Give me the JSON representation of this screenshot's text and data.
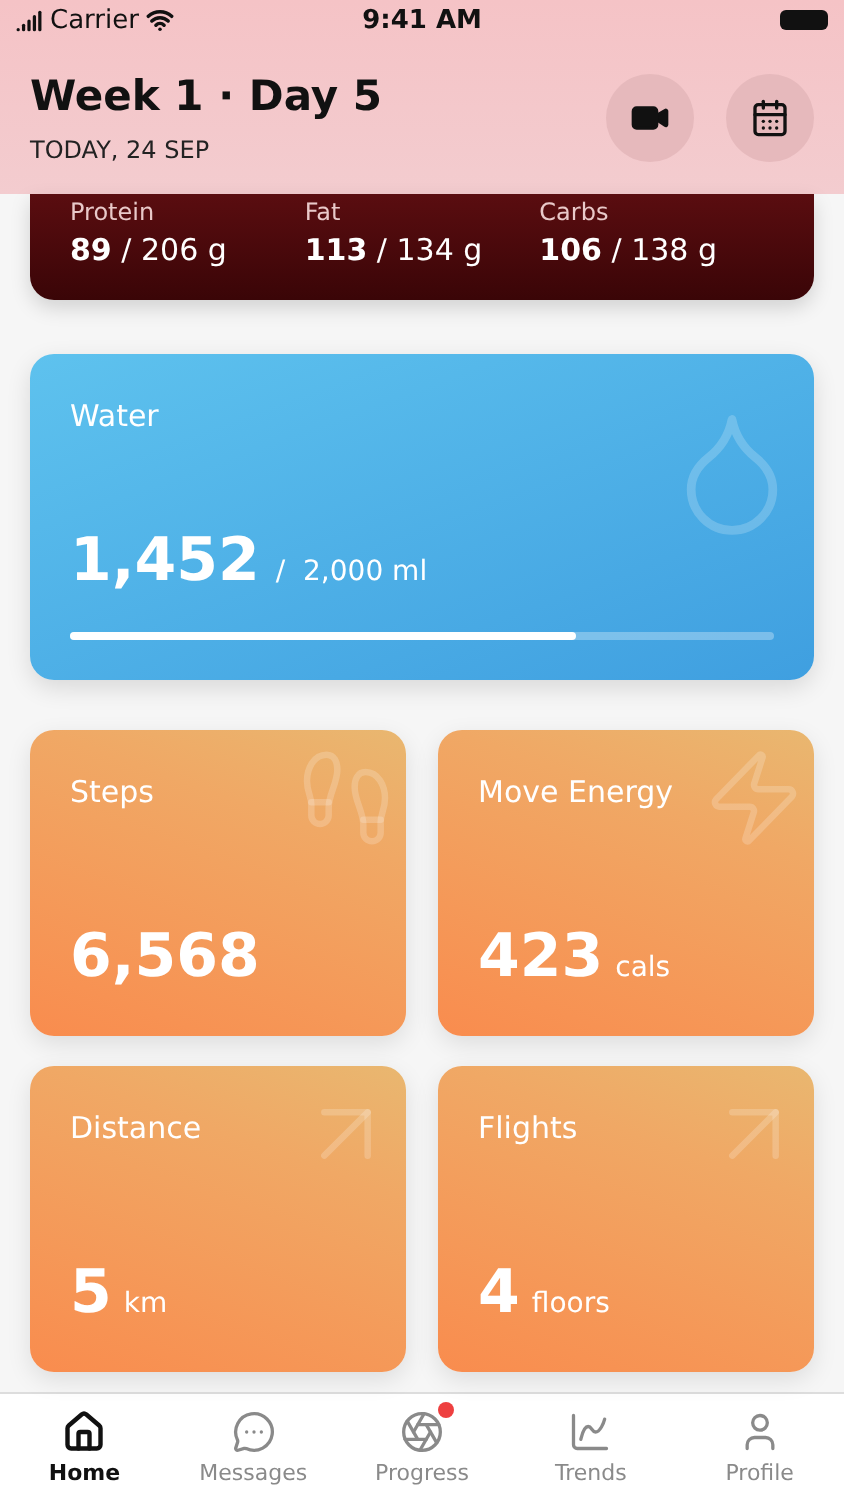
{
  "status_bar": {
    "carrier": "Carrier",
    "time": "9:41 AM"
  },
  "header": {
    "title": "Week 1 · Day 5",
    "subtitle": "TODAY, 24 SEP"
  },
  "macros": [
    {
      "label": "Protein",
      "value": "89",
      "target": "/ 206 g"
    },
    {
      "label": "Fat",
      "value": "113",
      "target": "/ 134 g"
    },
    {
      "label": "Carbs",
      "value": "106",
      "target": "/ 138 g"
    }
  ],
  "water": {
    "title": "Water",
    "value": "1,452",
    "target": "/  2,000 ml",
    "level": 0.72
  },
  "metrics": [
    {
      "title": "Steps",
      "value": "6,568"
    },
    {
      "title": "Move Energy",
      "value": "423",
      "unit": "cals"
    },
    {
      "title": "Distance",
      "value": "5",
      "unit": "km"
    },
    {
      "title": "Flights",
      "value": "4",
      "unit": "floors"
    }
  ],
  "tabs": [
    {
      "label": "Home",
      "selected": true,
      "badge": false
    },
    {
      "label": "Messages",
      "selected": false,
      "badge": false
    },
    {
      "label": "Progress",
      "selected": false,
      "badge": true
    },
    {
      "label": "Trends",
      "selected": false,
      "badge": false
    },
    {
      "label": "Profile",
      "selected": false,
      "badge": false
    }
  ]
}
